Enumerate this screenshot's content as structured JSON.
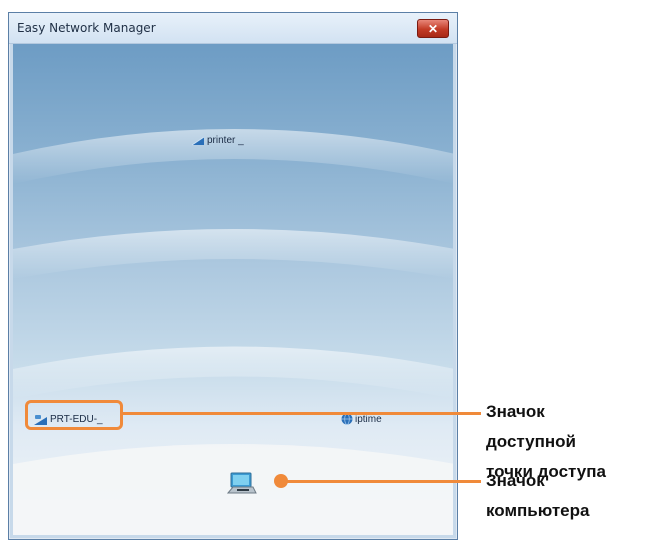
{
  "window": {
    "title": "Easy Network Manager",
    "close_symbol": "✕"
  },
  "network_map": {
    "printer_label": "printer _",
    "access_point_1_label": "PRT-EDU-_",
    "access_point_2_label": "iptime"
  },
  "annotations": {
    "access_point_icon_label_lines": [
      "Значок",
      "доступной",
      "точки доступа"
    ],
    "computer_icon_label_lines": [
      "Значок",
      "компьютера"
    ]
  },
  "colors": {
    "callout_orange": "#f08a3a",
    "close_red": "#c23a25"
  },
  "icons": {
    "printer": "printer-icon",
    "access_point_1": "access-point-icon",
    "access_point_2": "globe-icon",
    "computer": "laptop-icon",
    "close": "close-icon"
  }
}
